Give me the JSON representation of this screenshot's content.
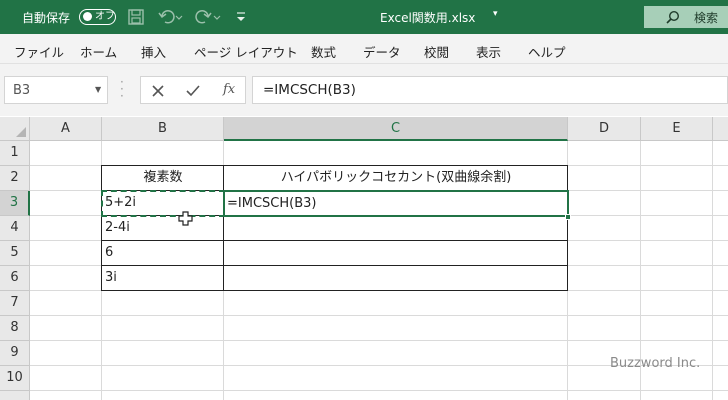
{
  "titlebar": {
    "autosave_label": "自動保存",
    "autosave_state": "オフ",
    "document_title": "Excel関数用.xlsx",
    "title_caret": "▾",
    "search_label": "検索"
  },
  "ribbon": {
    "tabs": [
      "ファイル",
      "ホーム",
      "挿入",
      "ページ レイアウト",
      "数式",
      "データ",
      "校閲",
      "表示",
      "ヘルプ"
    ]
  },
  "formula_bar": {
    "name_box": "B3",
    "formula": "=IMCSCH(B3)",
    "fx_label": "fx"
  },
  "grid": {
    "columns": [
      "A",
      "B",
      "C",
      "D",
      "E"
    ],
    "rows": [
      "1",
      "2",
      "3",
      "4",
      "5",
      "6",
      "7",
      "8",
      "9",
      "10"
    ],
    "active_column": "C",
    "active_row": "3"
  },
  "table": {
    "header_b": "複素数",
    "header_c": "ハイパボリックコセカント(双曲線余割)",
    "values_b": [
      "5+2i",
      "2-4i",
      "6",
      "3i"
    ],
    "c3_edit": "=IMCSCH(B3)"
  },
  "watermark": "Buzzword Inc.",
  "colors": {
    "accent": "#217346"
  }
}
